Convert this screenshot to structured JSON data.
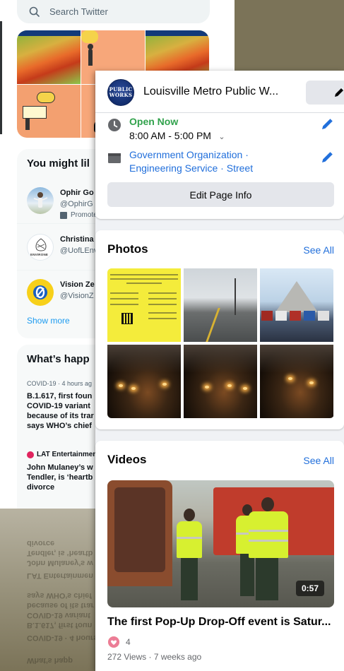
{
  "twitter": {
    "search_placeholder": "Search Twitter",
    "might_like_title": "You might lil",
    "suggestions": [
      {
        "name": "Ophir Go",
        "handle": "@OphirG",
        "promoted": "Promote"
      },
      {
        "name": "Christina",
        "handle": "@UofLEnv",
        "avatar_text": "ENVIRONE"
      },
      {
        "name": "Vision Ze",
        "handle": "@VisionZ"
      }
    ],
    "show_more": "Show more",
    "happening_title": "What’s happ",
    "trends": [
      {
        "meta": "COVID-19 · 4 hours ag",
        "text": "B.1.617, first foun\nCOVID-19 variant\nbecause of its trar\nsays WHO’s chief"
      },
      {
        "source": "LAT Entertainmen",
        "text": "John Mulaney’s w\nTendler, is ‘heartb\ndivorce"
      }
    ],
    "reflection_lines": [
      "divorce",
      "Tendler, is ‘heartb",
      "John Mulaney’s w",
      "LAT Entertainmen",
      "",
      "says WHO’s chief",
      "because of its trar",
      "COVID-19 variant",
      "B.1.617, first foun",
      "COVID-19 · 4 hours ag",
      "",
      "What’s happ"
    ]
  },
  "facebook": {
    "page_name": "Louisville Metro Public W...",
    "logo_text_top": "PUBLIC",
    "logo_text_bottom": "WORKS",
    "hours_status": "Open Now",
    "hours_range": "8:00 AM - 5:00 PM",
    "hours_chevron": "⌄",
    "category_line1": "Government Organization ·",
    "category_line2": "Engineering Service · Street",
    "edit_page_info": "Edit Page Info",
    "photos_title": "Photos",
    "photos_see_all": "See All",
    "videos_title": "Videos",
    "videos_see_all": "See All",
    "video": {
      "duration": "0:57",
      "title": "The first Pop-Up Drop-Off event is Satur...",
      "reaction_count": "4",
      "meta": "272 Views · 7 weeks ago"
    },
    "colors": {
      "open_green": "#31a24c",
      "link_blue": "#216fdb",
      "button_gray": "#e4e6eb"
    },
    "icons": [
      "clock-icon",
      "category-icon",
      "pencil-icon",
      "care-reaction-icon"
    ]
  }
}
